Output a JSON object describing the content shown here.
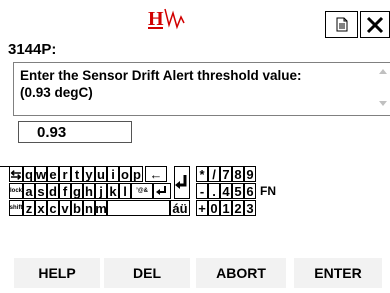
{
  "header": {
    "logo_icon": "hw-logo-icon",
    "doc_icon": "document-icon",
    "close_icon": "close-icon"
  },
  "device": {
    "code": "3144P:"
  },
  "prompt": {
    "text": "Enter the Sensor Drift Alert threshold value:\n(0.93 degC)"
  },
  "input": {
    "value": "0.93"
  },
  "keyboard": {
    "row1": [
      "q",
      "w",
      "e",
      "r",
      "t",
      "y",
      "u",
      "i",
      "o",
      "p"
    ],
    "row2": [
      "a",
      "s",
      "d",
      "f",
      "g",
      "h",
      "j",
      "k",
      "l"
    ],
    "row3": [
      "z",
      "x",
      "c",
      "v",
      "b",
      "n",
      "m"
    ],
    "row1_sym": [
      "*",
      "/"
    ],
    "row2_sym": "-",
    "row3_sym": "+",
    "row1_num": [
      "7",
      "8",
      "9"
    ],
    "row2_num": [
      "4",
      "5",
      "6"
    ],
    "row3_num": [
      "0",
      "1",
      "2",
      "3"
    ],
    "fn_label": "FN",
    "tab_label": "⇆",
    "lock_label": "lock",
    "shift_label": "shift",
    "at_label": "’@&",
    "accent_label": "áü",
    "backspace_label": "←",
    "dot_label": "."
  },
  "actions": {
    "help": "HELP",
    "del": "DEL",
    "abort": "ABORT",
    "enter": "ENTER"
  },
  "colors": {
    "logo": "#d10000",
    "button_bg": "#f2f2f2"
  }
}
